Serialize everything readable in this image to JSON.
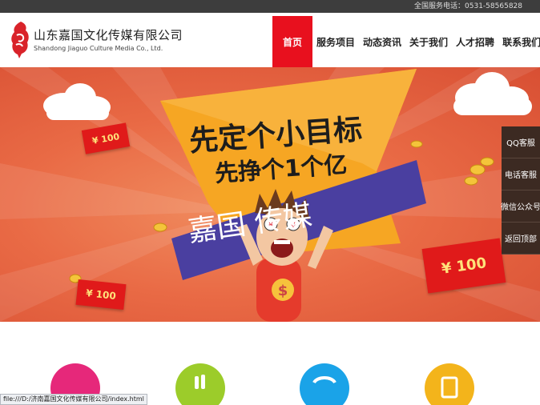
{
  "topbar": {
    "hotline": "全国服务电话：0531-58565828"
  },
  "brand": {
    "name_cn": "山东嘉国文化传媒有限公司",
    "name_en": "Shandong Jiaguo Culture Media Co., Ltd."
  },
  "nav": {
    "items": [
      {
        "label": "首页",
        "active": true
      },
      {
        "label": "服务项目",
        "active": false
      },
      {
        "label": "动态资讯",
        "active": false
      },
      {
        "label": "关于我们",
        "active": false
      },
      {
        "label": "人才招聘",
        "active": false
      },
      {
        "label": "联系我们",
        "active": false
      }
    ]
  },
  "banner": {
    "slogan_line1": "先定个小目标",
    "slogan_line2": "先挣个1个亿",
    "brand_text": "嘉国  传媒",
    "envelopes": [
      "¥ 100",
      "¥ 100",
      "¥ 100"
    ],
    "colors": {
      "background": "#e96a45",
      "flag": "#f6a623",
      "ribbon": "#4a3fa0",
      "envelope": "#e01a1a"
    }
  },
  "sidepanel": {
    "items": [
      "QQ客服",
      "电话客服",
      "微信公众号",
      "返回顶部"
    ]
  },
  "services": {
    "icons": [
      {
        "name": "magenta-circle-icon",
        "color": "#e6287a"
      },
      {
        "name": "green-circle-icon",
        "color": "#9ccc2a"
      },
      {
        "name": "phone-circle-icon",
        "color": "#1aa3e8"
      },
      {
        "name": "orange-circle-icon",
        "color": "#f3b41b"
      }
    ]
  },
  "statusbar": {
    "url": "file:///D:/济南嘉国文化传媒有限公司/index.html"
  }
}
